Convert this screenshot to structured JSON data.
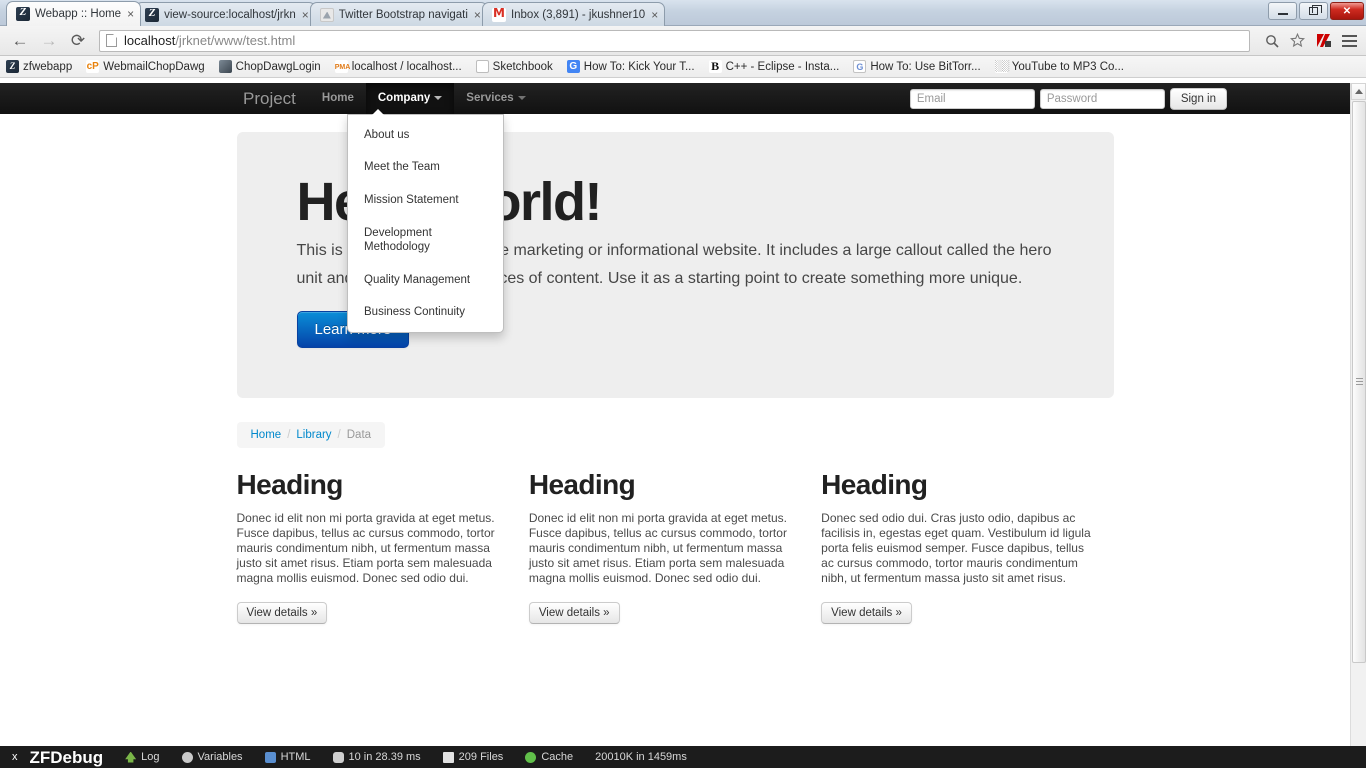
{
  "browser": {
    "tabs": [
      {
        "title": "Webapp :: Home",
        "favicon": "zf-icon",
        "active": true,
        "close_label": "×"
      },
      {
        "title": "view-source:localhost/jrkn",
        "favicon": "zf-icon",
        "active": false,
        "close_label": "×"
      },
      {
        "title": "Twitter Bootstrap navigati",
        "favicon": "bootstrap-icon",
        "active": false,
        "close_label": "×"
      },
      {
        "title": "Inbox (3,891) - jkushner10",
        "favicon": "gmail-icon",
        "active": false,
        "close_label": "×"
      }
    ],
    "window_controls": {
      "minimize": "minimize-icon",
      "restore": "restore-icon",
      "close": "✕"
    },
    "toolbar": {
      "back": "←",
      "forward": "→",
      "reload": "⟳",
      "url_host": "localhost",
      "url_rest": "/jrknet/www/test.html",
      "search_icon": "search-icon",
      "bookmark_icon": "☆",
      "extension_icon": "kaspersky-icon",
      "menu_icon": "hamburger-menu-icon"
    },
    "bookmarks": [
      {
        "label": "zfwebapp",
        "icon": "zf-icon",
        "glyph": "Z"
      },
      {
        "label": "WebmailChopDawg",
        "icon": "cpanel-icon",
        "glyph": "cP"
      },
      {
        "label": "ChopDawgLogin",
        "icon": "photo-icon",
        "glyph": ""
      },
      {
        "label": "localhost / localhost...",
        "icon": "phpmyadmin-icon",
        "glyph": "PMA"
      },
      {
        "label": "Sketchbook",
        "icon": "page-icon",
        "glyph": ""
      },
      {
        "label": "How To: Kick Your T...",
        "icon": "google-icon",
        "glyph": "G"
      },
      {
        "label": "C++ - Eclipse - Insta...",
        "icon": "blogger-icon",
        "glyph": "B"
      },
      {
        "label": "How To: Use BitTorr...",
        "icon": "google-doc-icon",
        "glyph": "G"
      },
      {
        "label": "YouTube to MP3 Co...",
        "icon": "grid-icon",
        "glyph": "░░"
      }
    ]
  },
  "page": {
    "navbar": {
      "brand": "Project",
      "items": [
        {
          "label": "Home",
          "active": false,
          "caret": false
        },
        {
          "label": "Company",
          "active": true,
          "caret": true
        },
        {
          "label": "Services",
          "active": false,
          "caret": true
        }
      ],
      "dropdown": {
        "open_for": "Company",
        "items": [
          {
            "label": "About us",
            "divider_after": false
          },
          {
            "label": "Meet the Team",
            "divider_after": true
          },
          {
            "label": "Mission Statement",
            "divider_after": true
          },
          {
            "label": "Development Methodology",
            "divider_after": true
          },
          {
            "label": "Quality Management",
            "divider_after": false
          },
          {
            "label": "Business Continuity",
            "divider_after": false
          }
        ]
      },
      "form": {
        "email_placeholder": "Email",
        "email_value": "",
        "password_placeholder": "Password",
        "password_value": "",
        "signin_label": "Sign in"
      }
    },
    "hero": {
      "title": "Hello, world!",
      "paragraph": "This is a template for a simple marketing or informational website. It includes a large callout called the hero unit and three supporting pieces of content. Use it as a starting point to create something more unique.",
      "cta_label": "Learn more"
    },
    "breadcrumb": {
      "items": [
        {
          "label": "Home",
          "link": true
        },
        {
          "label": "Library",
          "link": true
        },
        {
          "label": "Data",
          "link": false
        }
      ],
      "divider": "/"
    },
    "columns": [
      {
        "heading": "Heading",
        "body": "Donec id elit non mi porta gravida at eget metus. Fusce dapibus, tellus ac cursus commodo, tortor mauris condimentum nibh, ut fermentum massa justo sit amet risus. Etiam porta sem malesuada magna mollis euismod. Donec sed odio dui.",
        "button": "View details »"
      },
      {
        "heading": "Heading",
        "body": "Donec id elit non mi porta gravida at eget metus. Fusce dapibus, tellus ac cursus commodo, tortor mauris condimentum nibh, ut fermentum massa justo sit amet risus. Etiam porta sem malesuada magna mollis euismod. Donec sed odio dui.",
        "button": "View details »"
      },
      {
        "heading": "Heading",
        "body": "Donec sed odio dui. Cras justo odio, dapibus ac facilisis in, egestas eget quam. Vestibulum id ligula porta felis euismod semper. Fusce dapibus, tellus ac cursus commodo, tortor mauris condimentum nibh, ut fermentum massa justo sit amet risus.",
        "button": "View details »"
      }
    ]
  },
  "zfdebug": {
    "close": "x",
    "brand": "ZFDebug",
    "items": [
      {
        "label": "Log",
        "icon": "log-icon"
      },
      {
        "label": "Variables",
        "icon": "variables-icon"
      },
      {
        "label": "HTML",
        "icon": "html-icon"
      },
      {
        "label": "10 in 28.39 ms",
        "icon": "database-icon"
      },
      {
        "label": "209 Files",
        "icon": "files-icon"
      },
      {
        "label": "Cache",
        "icon": "cache-icon"
      },
      {
        "label": "20010K in 1459ms",
        "icon": ""
      }
    ]
  },
  "colors": {
    "navbar_bg": "#111111",
    "hero_bg": "#eeeeee",
    "primary_button": "#0a8ed8",
    "link": "#0088cc",
    "debug_bar": "#1c1c1c"
  }
}
